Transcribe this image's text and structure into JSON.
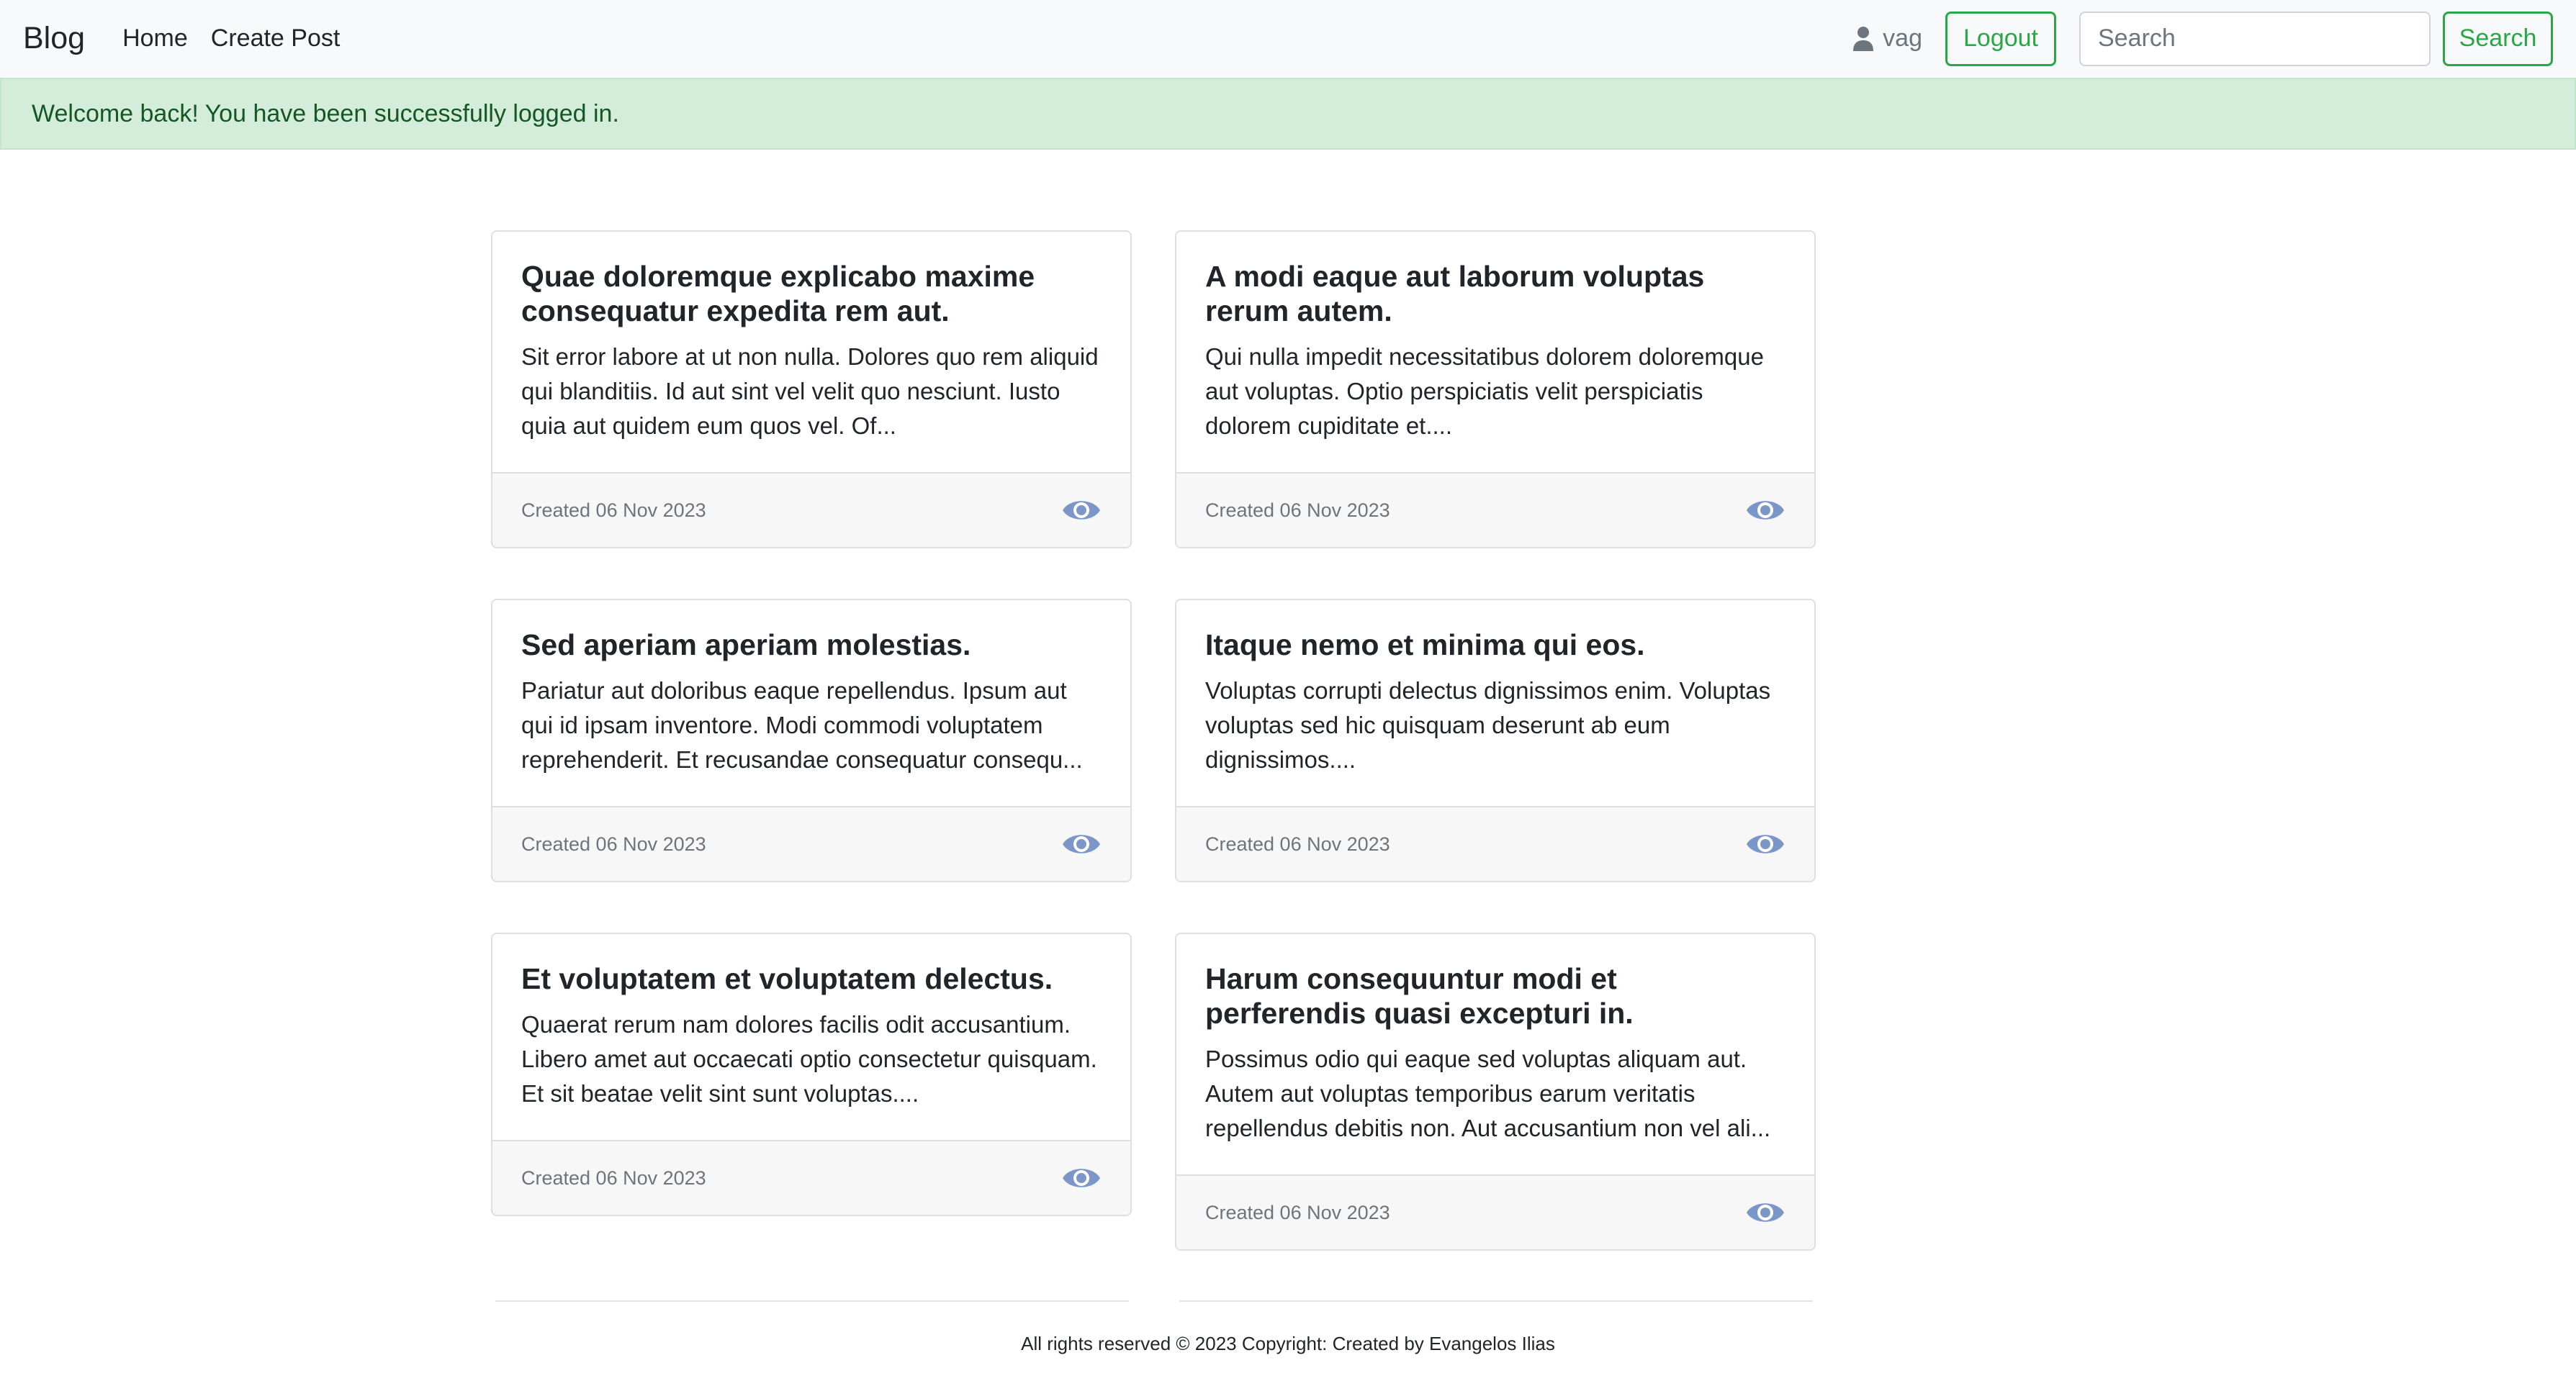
{
  "navbar": {
    "brand": "Blog",
    "links": [
      "Home",
      "Create Post"
    ],
    "user_icon": "user-icon",
    "username": "vag",
    "logout_label": "Logout",
    "search_placeholder": "Search",
    "search_button": "Search",
    "accent_color": "#28a745"
  },
  "alert": {
    "message": "Welcome back! You have been successfully logged in.",
    "color": "#d4edda"
  },
  "posts": [
    {
      "title": "Quae doloremque explicabo maxime consequatur expedita rem aut.",
      "excerpt": "Sit error labore at ut non nulla. Dolores quo rem aliquid qui blanditiis. Id aut sint vel velit quo nesciunt. Iusto quia aut quidem eum quos vel. Of...",
      "created": "Created 06 Nov 2023",
      "view_icon": "eye-icon"
    },
    {
      "title": "A modi eaque aut laborum voluptas rerum autem.",
      "excerpt": "Qui nulla impedit necessitatibus dolorem doloremque aut voluptas. Optio perspiciatis velit perspiciatis dolorem cupiditate et....",
      "created": "Created 06 Nov 2023",
      "view_icon": "eye-icon"
    },
    {
      "title": "Sed aperiam aperiam molestias.",
      "excerpt": "Pariatur aut doloribus eaque repellendus. Ipsum aut qui id ipsam inventore. Modi commodi voluptatem reprehenderit. Et recusandae consequatur consequ...",
      "created": "Created 06 Nov 2023",
      "view_icon": "eye-icon"
    },
    {
      "title": "Itaque nemo et minima qui eos.",
      "excerpt": "Voluptas corrupti delectus dignissimos enim. Voluptas voluptas sed hic quisquam deserunt ab eum dignissimos....",
      "created": "Created 06 Nov 2023",
      "view_icon": "eye-icon"
    },
    {
      "title": "Et voluptatem et voluptatem delectus.",
      "excerpt": "Quaerat rerum nam dolores facilis odit accusantium. Libero amet aut occaecati optio consectetur quisquam. Et sit beatae velit sint sunt voluptas....",
      "created": "Created 06 Nov 2023",
      "view_icon": "eye-icon"
    },
    {
      "title": "Harum consequuntur modi et perferendis quasi excepturi in.",
      "excerpt": "Possimus odio qui eaque sed voluptas aliquam aut. Autem aut voluptas temporibus earum veritatis repellendus debitis non. Aut accusantium non vel ali...",
      "created": "Created 06 Nov 2023",
      "view_icon": "eye-icon"
    }
  ],
  "footer": {
    "text": "All rights reserved © 2023 Copyright: Created by Evangelos Ilias"
  }
}
